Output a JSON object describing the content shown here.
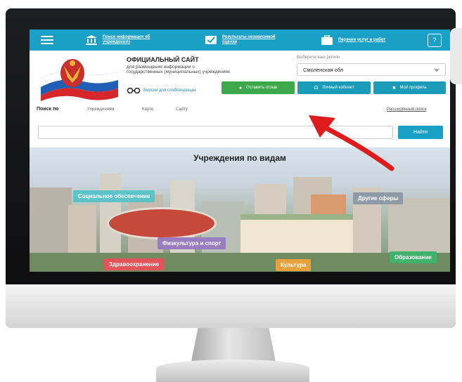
{
  "topbar": {
    "items": [
      {
        "label": "Поиск информации об учреждениях",
        "icon": "building-icon"
      },
      {
        "label": "Результаты независимой оценки",
        "icon": "checkmark-icon"
      },
      {
        "label": "Перечни услуг и работ",
        "icon": "briefcase-icon"
      }
    ],
    "help_label": "?"
  },
  "header": {
    "title": "ОФИЦИАЛЬНЫЙ САЙТ",
    "subtitle": "для размещения информации о государственных (муниципальных) учреждениях",
    "accessibility_label": "Версия для слабовидящих"
  },
  "region": {
    "caption": "Выберите ваш регион",
    "value": "Смоленская обл"
  },
  "buttons": {
    "feedback": "Оставить отзыв",
    "cabinet": "Личный кабинет",
    "profile": "Мой профиль"
  },
  "search": {
    "label": "Поиск по",
    "tabs": [
      "Учреждениям",
      "Карте",
      "Сайту"
    ],
    "advanced": "Расширенный поиск",
    "submit": "Найти",
    "value": ""
  },
  "section": {
    "title": "Учреждения по видам",
    "categories": [
      {
        "label": "Социальное обеспечение",
        "color": "#5cc3c9"
      },
      {
        "label": "Другие сферы",
        "color": "#8e9aa6"
      },
      {
        "label": "Физкультура и спорт",
        "color": "#9a7cc1"
      },
      {
        "label": "Здравоохранение",
        "color": "#e2545a"
      },
      {
        "label": "Культура",
        "color": "#e9a13b"
      },
      {
        "label": "Образование",
        "color": "#3fb26b"
      }
    ]
  },
  "colors": {
    "accent": "#19a0c4",
    "feedback_button": "#3fa84a",
    "cabinet_button": "#1a9bb8",
    "arrow": "#e01b1b"
  }
}
